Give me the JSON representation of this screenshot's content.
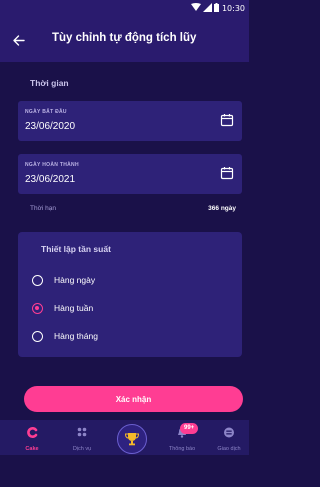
{
  "status_bar": {
    "time": "10:30"
  },
  "header": {
    "title": "Tùy chỉnh tự động tích lũy",
    "back_icon": "arrow-left-icon"
  },
  "time_section": {
    "label": "Thời gian",
    "start": {
      "label": "NGÀY BẮT ĐẦU",
      "value": "23/06/2020",
      "icon": "calendar-icon"
    },
    "end": {
      "label": "NGÀY HOÀN THÀNH",
      "value": "23/06/2021",
      "icon": "calendar-icon"
    },
    "duration_label": "Thời hạn",
    "duration_value": "366 ngày"
  },
  "frequency": {
    "title": "Thiết lập tần suất",
    "options": [
      {
        "label": "Hàng ngày",
        "selected": false
      },
      {
        "label": "Hàng tuần",
        "selected": true
      },
      {
        "label": "Hàng tháng",
        "selected": false
      }
    ]
  },
  "confirm_label": "Xác nhận",
  "nav": {
    "items": [
      {
        "label": "Cake",
        "icon": "cake-logo-icon",
        "active": true
      },
      {
        "label": "Dịch vụ",
        "icon": "grid-icon",
        "active": false
      },
      {
        "label": "",
        "icon": "trophy-icon",
        "active": false
      },
      {
        "label": "Thông báo",
        "icon": "bell-icon",
        "active": false
      },
      {
        "label": "Giao dịch",
        "icon": "transaction-icon",
        "active": false
      }
    ],
    "badge": "99+"
  },
  "colors": {
    "background": "#1a1149",
    "header": "#2a1b6e",
    "card": "#2e2278",
    "accent": "#ff3d93"
  }
}
